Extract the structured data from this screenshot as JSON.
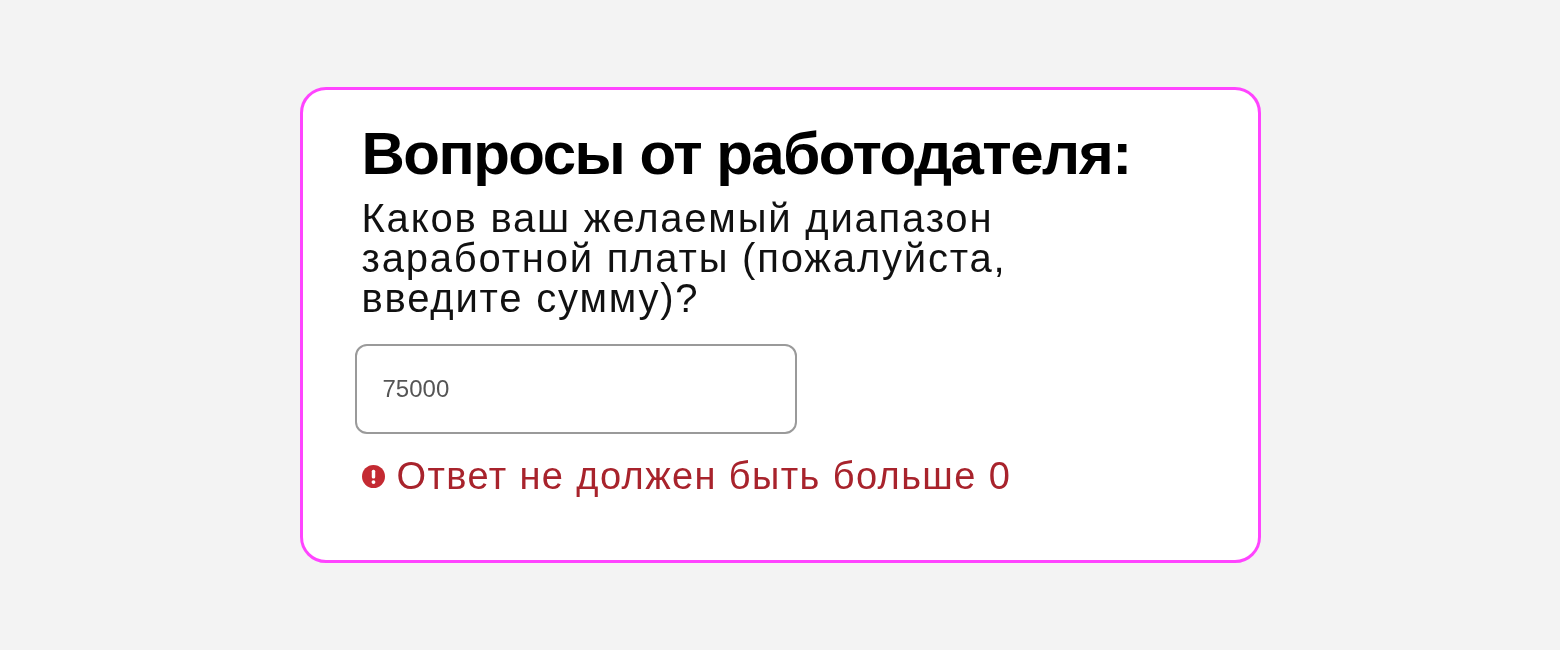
{
  "card": {
    "title": "Вопросы от работодателя:",
    "question": "Каков ваш желаемый диапазон заработной платы (пожалуйста, введите сумму)?",
    "answer_field": {
      "value": "75000"
    },
    "error": {
      "message": "Ответ не должен быть больше 0"
    }
  }
}
